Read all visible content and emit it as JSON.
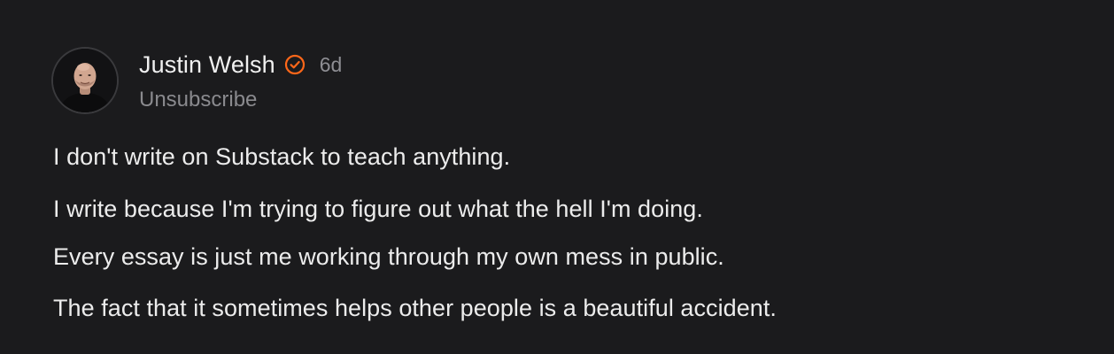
{
  "note": {
    "author": {
      "name": "Justin Welsh",
      "verified_icon": "verified-check-icon",
      "verified_color": "#ff6719",
      "timestamp": "6d",
      "unsubscribe_label": "Unsubscribe",
      "avatar": "author-avatar-photo"
    },
    "body": [
      "I don't write on Substack to teach anything.",
      "I write because I'm trying to figure out what the hell I'm doing.",
      "Every essay is just me working through my own mess in public.",
      "The fact that it sometimes helps other people is a beautiful accident."
    ]
  },
  "colors": {
    "background": "#1b1b1d",
    "text_primary": "#ececec",
    "text_secondary": "#8e8e93",
    "accent": "#ff6719"
  }
}
